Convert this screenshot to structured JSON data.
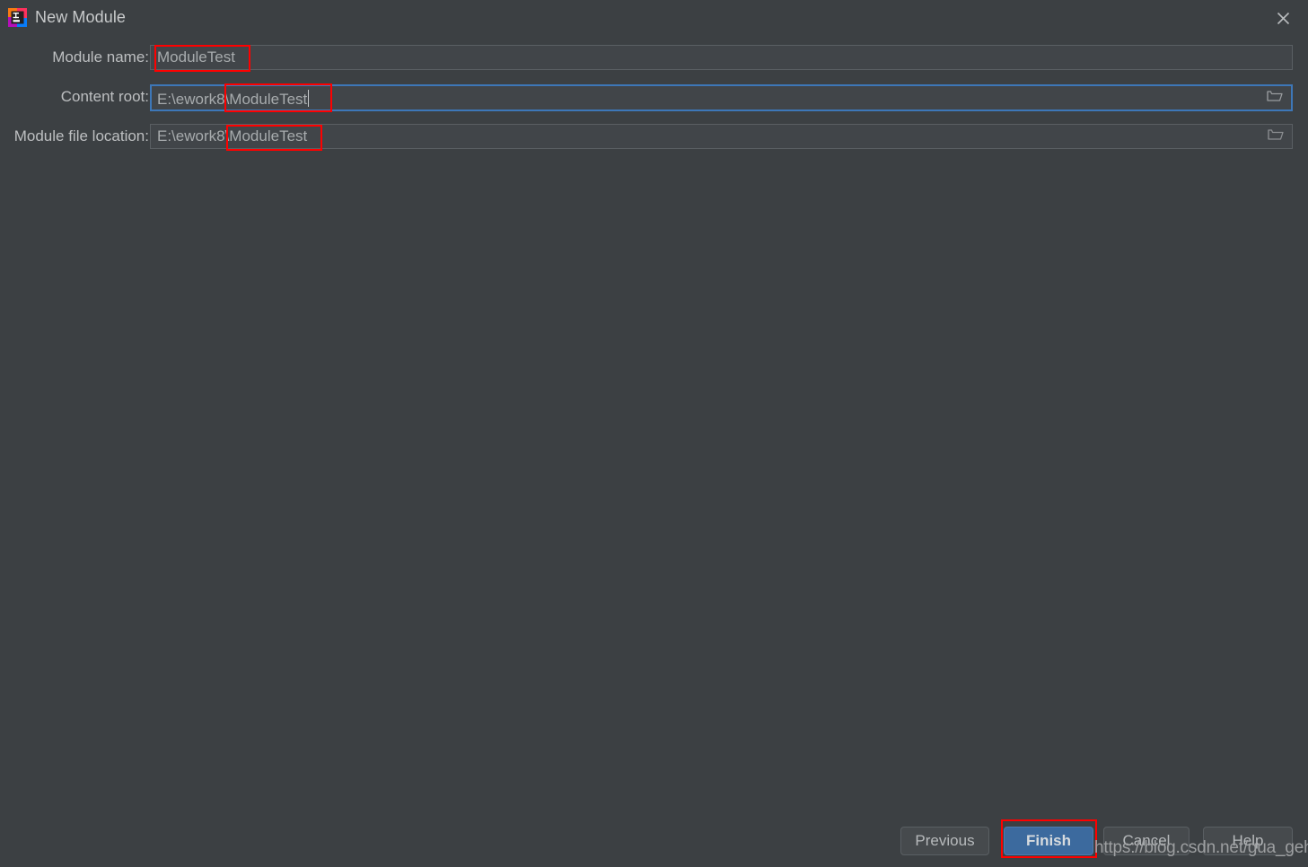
{
  "window": {
    "title": "New Module",
    "app_icon": "intellij-idea-icon",
    "close_icon": "close-icon",
    "background_color": "#3c4043",
    "accent_color": "#3d77b8",
    "annotation_color": "#ff0000"
  },
  "form": {
    "rows": [
      {
        "label": "Module name:",
        "value": "ModuleTest",
        "placeholder": "Module name",
        "focused": false,
        "has_browse": false,
        "browse_icon": "",
        "annotated": true
      },
      {
        "label": "Content root:",
        "value": "E:\\ework8\\ModuleTest",
        "placeholder": "Content root path",
        "focused": true,
        "has_browse": true,
        "browse_icon": "folder-icon",
        "annotated": true
      },
      {
        "label": "Module file location:",
        "value": "E:\\ework8\\ModuleTest",
        "placeholder": "Module file location path",
        "focused": false,
        "has_browse": true,
        "browse_icon": "folder-icon",
        "annotated": true
      }
    ]
  },
  "buttons": {
    "previous": "Previous",
    "finish": "Finish",
    "cancel": "Cancel",
    "help": "Help"
  },
  "watermark": {
    "text": "https://blog.csdn.net/gua_gehao"
  }
}
